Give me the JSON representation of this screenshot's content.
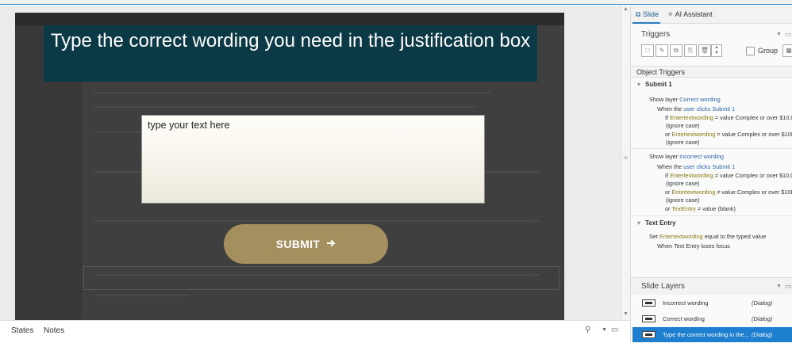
{
  "slide": {
    "title_text": "Type the correct wording you need in the justification box",
    "text_entry_placeholder": "type your text here",
    "submit_label": "SUBMIT",
    "submit_icon": "arrow-right-icon"
  },
  "bottom": {
    "states_label": "States",
    "notes_label": "Notes"
  },
  "panel": {
    "tabs": [
      {
        "label": "Slide",
        "icon": "slide-icon",
        "active": true
      },
      {
        "label": "AI Assistant",
        "icon": "sparkle-icon",
        "active": false
      }
    ],
    "triggers_title": "Triggers",
    "group_label": "Group",
    "object_triggers_title": "Object Triggers",
    "submit1": {
      "name": "Submit 1",
      "trigger1": {
        "show_layer_prefix": "Show layer",
        "layer": "Correct wording",
        "when_prefix": "When the",
        "user_clicks": "user clicks",
        "target": "Submit 1",
        "cond1_if": "If",
        "cond1_var": "Entertextwording",
        "cond1_op": "= value",
        "cond1_val": "Complex or over $10,0",
        "cond1_case": "(ignore case)",
        "cond2_or": "or",
        "cond2_var": "Entertextwording",
        "cond2_op": "= value",
        "cond2_val": "Complex or over $10K",
        "cond2_case": "(ignore case)"
      },
      "trigger2": {
        "show_layer_prefix": "Show layer",
        "layer": "Incorrect wording",
        "when_prefix": "When the",
        "user_clicks": "user clicks",
        "target": "Submit 1",
        "cond1_if": "If",
        "cond1_var": "Entertextwording",
        "cond1_op": "≠ value",
        "cond1_val": "Complex or over $10,0",
        "cond1_case": "(ignore case)",
        "cond2_or": "or",
        "cond2_var": "Entertextwording",
        "cond2_op": "≠ value",
        "cond2_val": "Complex or over $10K",
        "cond2_case": "(ignore case)",
        "cond3_or": "or",
        "cond3_var": "TextEntry",
        "cond3_op": "= value",
        "cond3_val": "(blank)"
      }
    },
    "text_entry": {
      "name": "Text Entry",
      "set_prefix": "Set",
      "var": "Entertextwording",
      "set_suffix": "equal to the typed value",
      "when": "When Text Entry loses focus"
    },
    "slide_layers_title": "Slide Layers",
    "layers": [
      {
        "name": "Incorrect wording",
        "type": "(Dialog)",
        "selected": false
      },
      {
        "name": "Correct wording",
        "type": "(Dialog)",
        "selected": false
      },
      {
        "name": "Type the correct wording in the...",
        "type": "(Dialog)",
        "selected": true
      }
    ]
  },
  "colors": {
    "title_bg": "#0b3a46",
    "submit_bg": "#a48f5e",
    "selection_blue": "#1e7fd1",
    "link_blue": "#2a66a8",
    "variable_olive": "#8a7a10"
  }
}
